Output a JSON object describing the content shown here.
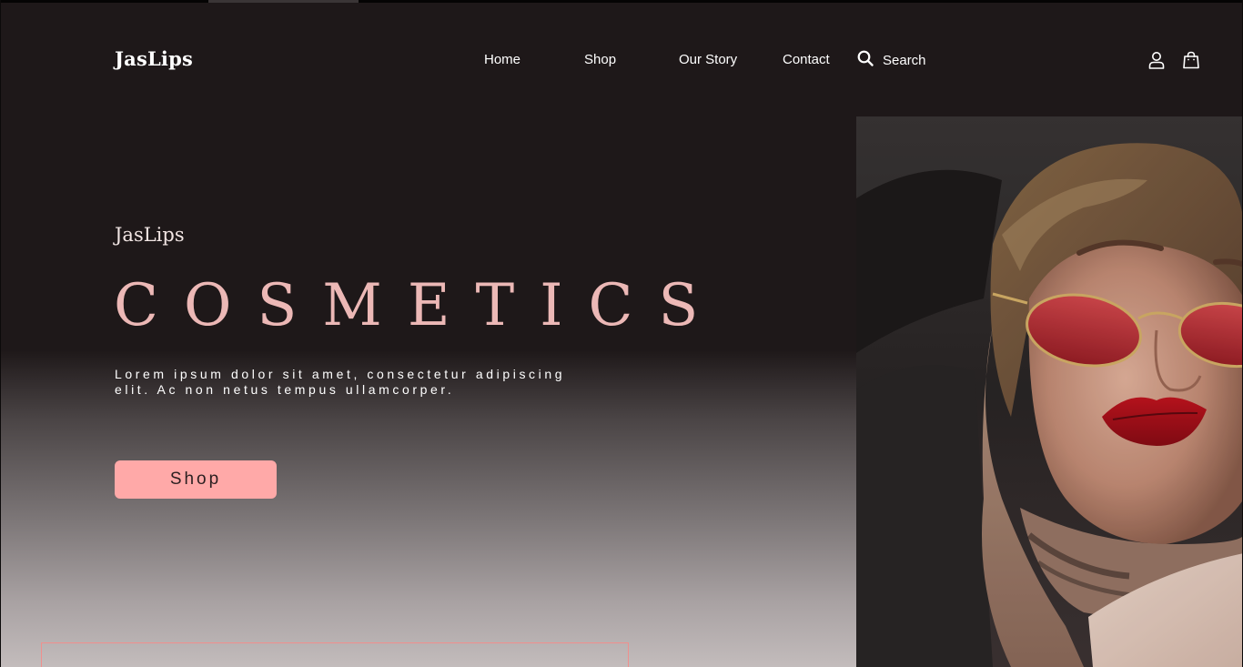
{
  "header": {
    "logo": "JasLips",
    "nav": [
      {
        "label": "Home"
      },
      {
        "label": "Shop"
      },
      {
        "label": "Our Story"
      },
      {
        "label": "Contact"
      }
    ],
    "search_label": "Search",
    "icons": [
      "search-icon",
      "user-icon",
      "shopping-bag-icon"
    ]
  },
  "hero": {
    "brand": "JasLips",
    "title": "COSMETICS",
    "description": "Lorem ipsum dolor sit amet, consectetur adipiscing elit. Ac non netus tempus ullamcorper.",
    "cta_label": "Shop",
    "image": "woman-red-sunglasses-red-lipstick-photo"
  },
  "colors": {
    "background": "#1e1819",
    "title_pink": "#ecb8b6",
    "button_pink": "#ffa9a8",
    "text_white": "#ffffff"
  }
}
